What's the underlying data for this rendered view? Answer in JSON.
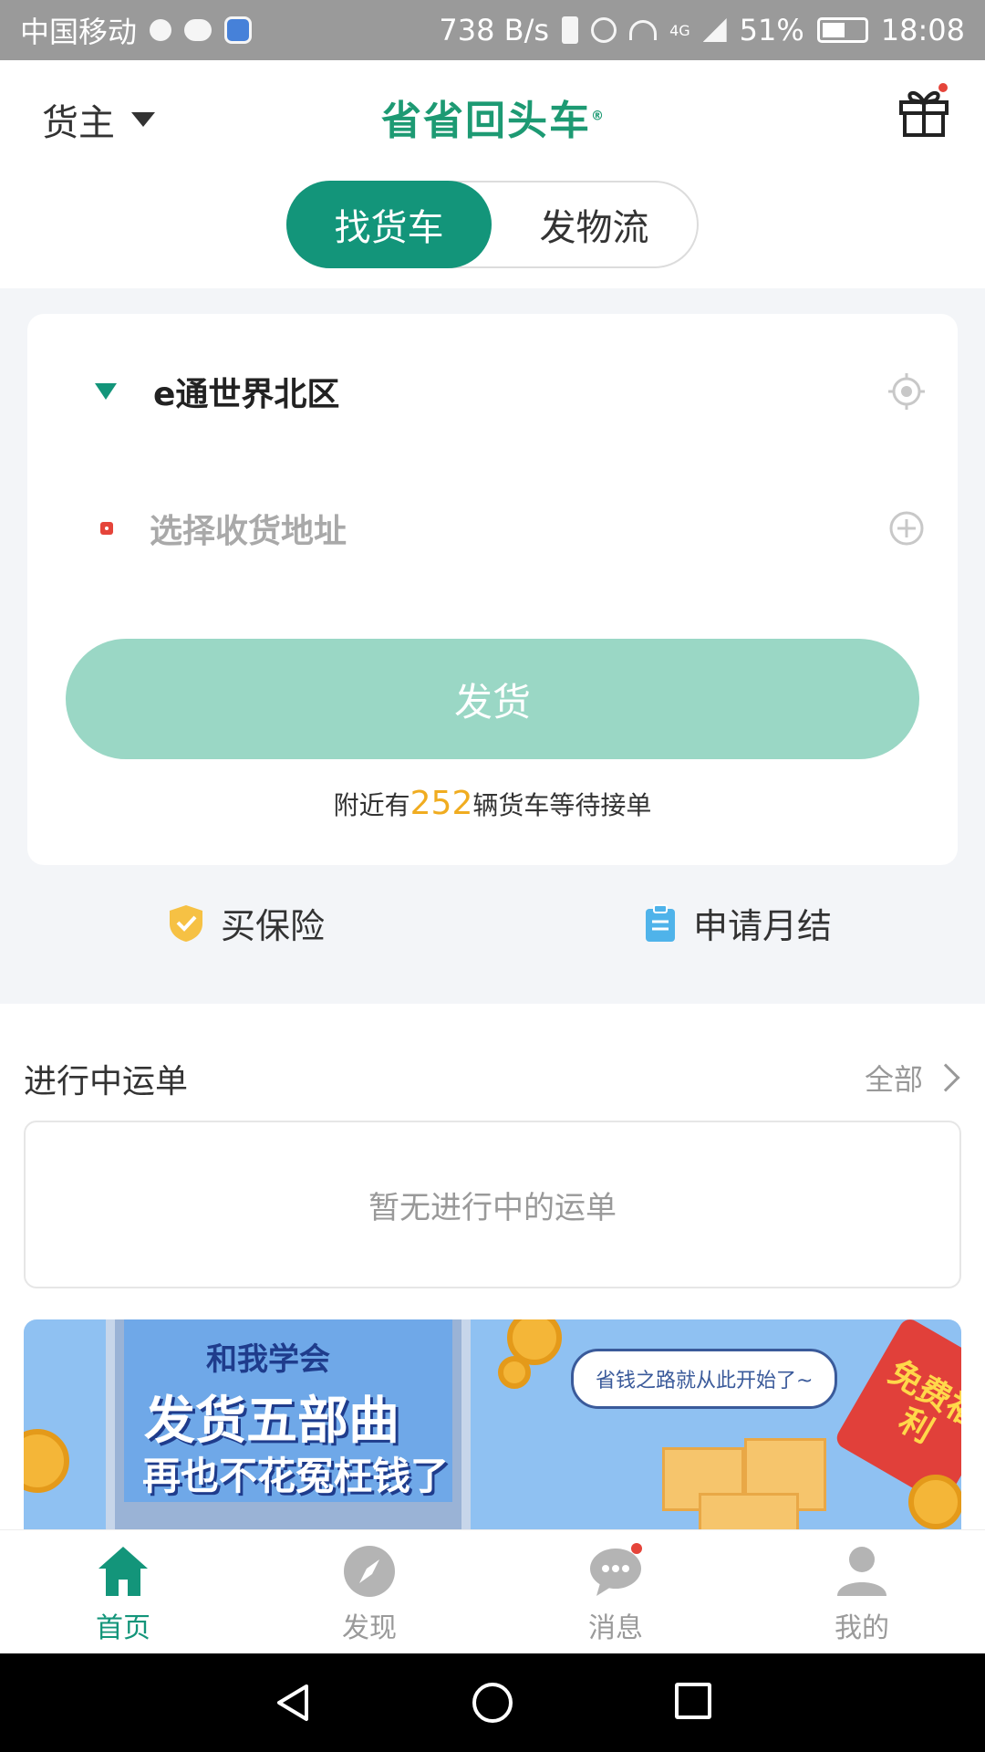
{
  "status_bar": {
    "carrier": "中国移动",
    "speed": "738 B/s",
    "network": "4G",
    "battery": "51%",
    "time": "18:08"
  },
  "header": {
    "role": "货主",
    "brand": "省省回头车",
    "brand_mark": "®"
  },
  "mode_tabs": [
    {
      "label": "找货车",
      "active": true
    },
    {
      "label": "发物流",
      "active": false
    }
  ],
  "shipment": {
    "from_address": "e通世界北区",
    "to_placeholder": "选择收货地址",
    "send_label": "发货",
    "nearby_prefix": "附近有",
    "nearby_count": "252",
    "nearby_suffix": "辆货车等待接单"
  },
  "quick_actions": {
    "insurance": "买保险",
    "monthly": "申请月结"
  },
  "orders": {
    "title": "进行中运单",
    "all_label": "全部",
    "empty_text": "暂无进行中的运单"
  },
  "banner": {
    "line1": "和我学会",
    "line2": "发货五部曲",
    "line3": "再也不花冤枉钱了",
    "bubble": "省钱之路就从此开始了~",
    "envelope": "免费福利"
  },
  "bottom_nav": [
    {
      "label": "首页",
      "icon": "home-icon",
      "active": true
    },
    {
      "label": "发现",
      "icon": "compass-icon",
      "active": false
    },
    {
      "label": "消息",
      "icon": "chat-icon",
      "active": false
    },
    {
      "label": "我的",
      "icon": "user-icon",
      "active": false
    }
  ],
  "colors": {
    "primary": "#13957a",
    "brand": "#1d9a73",
    "button_disabled": "#9ad7c5",
    "accent_count": "#f0ac20",
    "alert": "#e5443a"
  }
}
